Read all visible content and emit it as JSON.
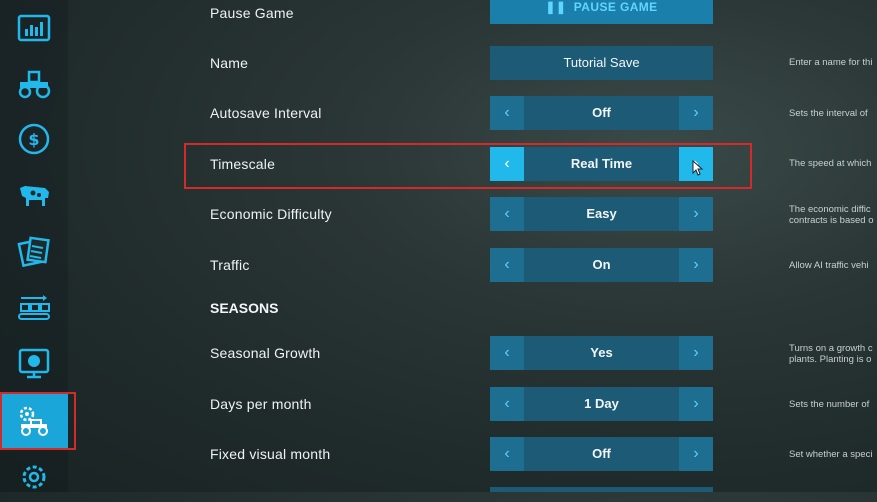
{
  "sidebar": {
    "items": [
      {
        "icon": "statistics-icon"
      },
      {
        "icon": "tractor-icon"
      },
      {
        "icon": "finances-icon"
      },
      {
        "icon": "animals-icon"
      },
      {
        "icon": "contracts-icon"
      },
      {
        "icon": "production-icon"
      },
      {
        "icon": "help-icon"
      },
      {
        "icon": "game-settings-icon",
        "active": true
      },
      {
        "icon": "general-settings-icon"
      }
    ]
  },
  "settings": {
    "pause_game": {
      "label": "Pause Game",
      "button": "PAUSE GAME"
    },
    "name": {
      "label": "Name",
      "value": "Tutorial Save",
      "desc": "Enter a name for thi"
    },
    "autosave": {
      "label": "Autosave Interval",
      "value": "Off",
      "desc": "Sets the interval of"
    },
    "timescale": {
      "label": "Timescale",
      "value": "Real Time",
      "desc": "The speed at which"
    },
    "economic": {
      "label": "Economic Difficulty",
      "value": "Easy",
      "desc1": "The economic diffic",
      "desc2": "contracts is based o"
    },
    "traffic": {
      "label": "Traffic",
      "value": "On",
      "desc": "Allow AI traffic vehi"
    },
    "seasons_heading": "SEASONS",
    "seasonal_growth": {
      "label": "Seasonal Growth",
      "value": "Yes",
      "desc1": "Turns on a growth c",
      "desc2": "plants. Planting is o"
    },
    "days_per_month": {
      "label": "Days per month",
      "value": "1 Day",
      "desc": "Sets the number of"
    },
    "fixed_visual_month": {
      "label": "Fixed visual month",
      "value": "Off",
      "desc": "Set whether a speci"
    }
  },
  "colors": {
    "accent": "#1aa6d8",
    "highlight": "#d52a2a",
    "control_bg": "#1d5a75"
  }
}
